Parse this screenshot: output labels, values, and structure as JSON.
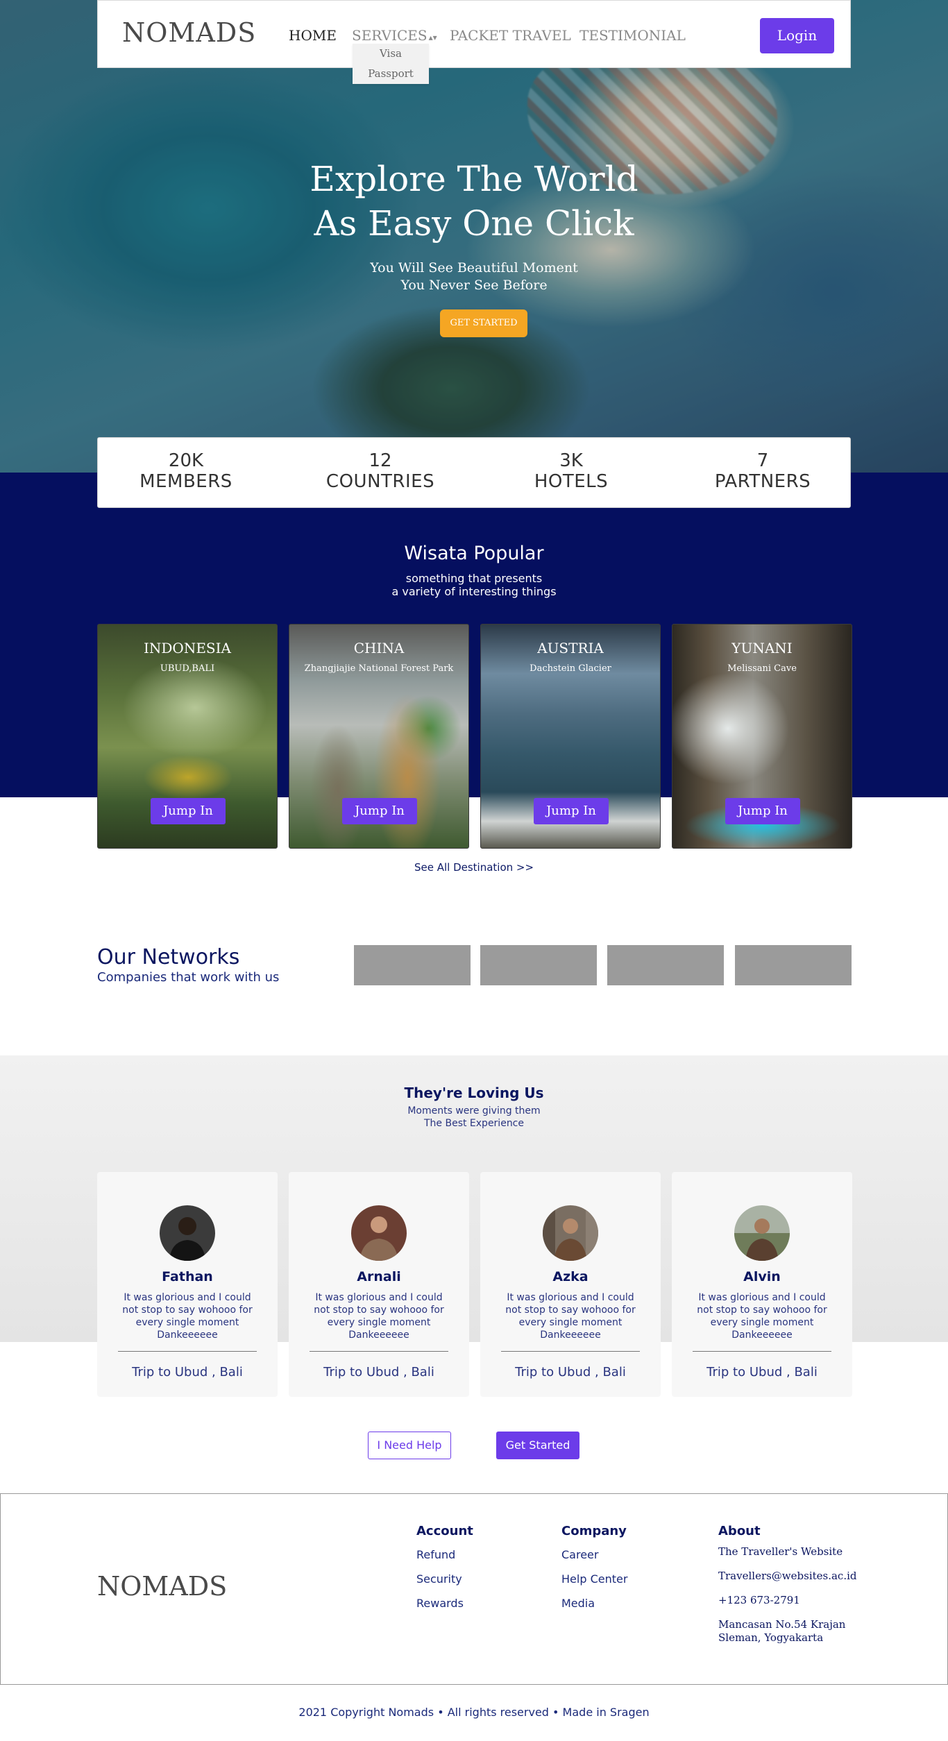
{
  "nav": {
    "brand": "NOMADS",
    "links": [
      "HOME",
      "SERVICES",
      "PACKET TRAVEL",
      "TESTIMONIAL"
    ],
    "services_caret": "▴▾",
    "dropdown": [
      "Visa",
      "Passport"
    ],
    "login": "Login"
  },
  "hero": {
    "title_line1": "Explore The World",
    "title_line2": "As Easy One Click",
    "sub_line1": "You Will See Beautiful Moment",
    "sub_line2": "You Never See Before",
    "cta": "GET STARTED"
  },
  "stats": [
    {
      "value": "20K",
      "label": "MEMBERS"
    },
    {
      "value": "12",
      "label": "COUNTRIES"
    },
    {
      "value": "3K",
      "label": "HOTELS"
    },
    {
      "value": "7",
      "label": "PARTNERS"
    }
  ],
  "popular": {
    "title": "Wisata Popular",
    "sub_line1": "something that presents",
    "sub_line2": "a variety of interesting things",
    "see_all": "See All Destination >>"
  },
  "destinations": [
    {
      "country": "INDONESIA",
      "place": "UBUD,BALI",
      "button": "Jump In"
    },
    {
      "country": "CHINA",
      "place": "Zhangjiajie National Forest Park",
      "button": "Jump In"
    },
    {
      "country": "AUSTRIA",
      "place": "Dachstein Glacier",
      "button": "Jump In"
    },
    {
      "country": "YUNANI",
      "place": "Melissani Cave",
      "button": "Jump In"
    }
  ],
  "networks": {
    "title": "Our Networks",
    "subtitle": "Companies that work with us"
  },
  "testimonials": {
    "title": "They're Loving Us",
    "sub_line1": "Moments were giving them",
    "sub_line2": "The Best Experience",
    "items": [
      {
        "name": "Fathan",
        "quote": "It was glorious and I could not stop to say wohooo for every single moment Dankeeeeee",
        "trip": "Trip to Ubud , Bali"
      },
      {
        "name": "Arnali",
        "quote": "It was glorious and I could not stop to say wohooo for every single moment Dankeeeeee",
        "trip": "Trip to Ubud , Bali"
      },
      {
        "name": "Azka",
        "quote": "It was glorious and I could not stop to say wohooo for every single moment Dankeeeeee",
        "trip": "Trip to Ubud , Bali"
      },
      {
        "name": "Alvin",
        "quote": "It was glorious and I could not stop to say wohooo for every single moment Dankeeeeee",
        "trip": "Trip to Ubud , Bali"
      }
    ]
  },
  "cta": {
    "help": "I Need Help",
    "start": "Get Started"
  },
  "footer": {
    "brand": "NOMADS",
    "account": {
      "title": "Account",
      "links": [
        "Refund",
        "Security",
        "Rewards"
      ]
    },
    "company": {
      "title": "Company",
      "links": [
        "Career",
        "Help Center",
        "Media"
      ]
    },
    "about": {
      "title": "About",
      "site": "The Traveller's Website",
      "email": "Travellers@websites.ac.id",
      "phone": "+123 673-2791",
      "address_line1": "Mancasan No.54 Krajan",
      "address_line2": "Sleman, Yogyakarta"
    },
    "copyright": "2021 Copyright Nomads • All rights reserved • Made in Sragen"
  },
  "colors": {
    "accent": "#6c3ce9",
    "navy": "#050f5f",
    "cta_orange": "#f5a623",
    "logo_placeholder": "#9b9b9b"
  }
}
